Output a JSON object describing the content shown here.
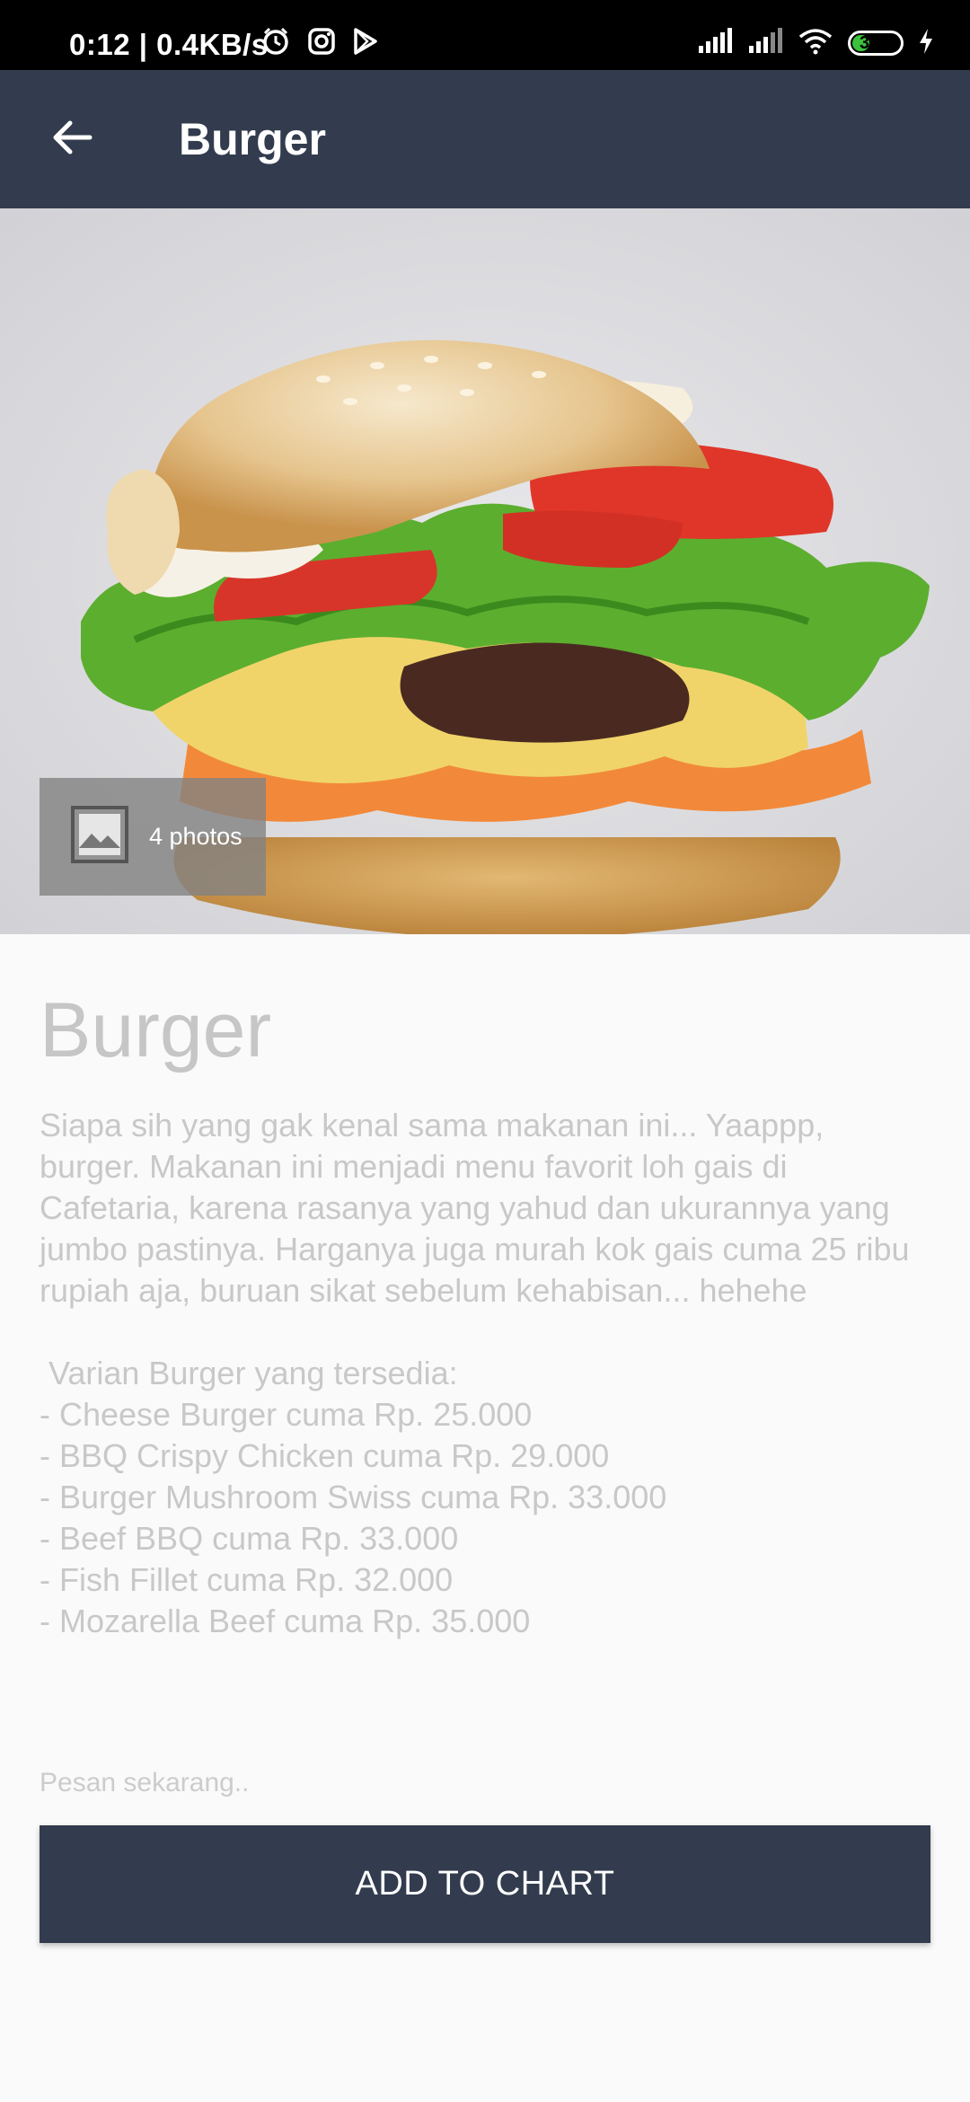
{
  "status_bar": {
    "time_speed": "0:12 | 0.4KB/s",
    "battery": "34",
    "icons": [
      "alarm-icon",
      "instagram-icon",
      "play-store-icon",
      "signal-icon",
      "signal-icon",
      "wifi-icon",
      "battery-icon",
      "charging-icon"
    ]
  },
  "app_bar": {
    "title": "Burger",
    "back_icon": "arrow-back-icon"
  },
  "hero": {
    "photo_count_label": "4 photos",
    "photo_icon": "image-icon"
  },
  "detail": {
    "title": "Burger",
    "description": "Siapa sih yang gak kenal sama makanan ini... Yaappp, burger. Makanan ini menjadi menu favorit loh gais di Cafetaria, karena rasanya yang yahud dan ukurannya yang jumbo pastinya. Harganya juga murah kok gais cuma 25 ribu rupiah aja, buruan sikat sebelum kehabisan... hehehe",
    "variants_title": "Varian Burger yang tersedia:",
    "variants": [
      "- Cheese Burger cuma Rp. 25.000",
      "- BBQ Crispy Chicken cuma Rp. 29.000",
      "- Burger Mushroom Swiss cuma Rp. 33.000",
      "- Beef BBQ cuma Rp. 33.000",
      "- Fish Fillet cuma Rp. 32.000",
      "- Mozarella Beef cuma Rp. 35.000"
    ]
  },
  "order": {
    "hint": "Pesan sekarang..",
    "button_label": "ADD TO CHART"
  },
  "colors": {
    "app_bar": "#333c4e",
    "button": "#333c4e",
    "text_muted": "#c8c8c8",
    "battery_fill": "#3cc13b"
  }
}
